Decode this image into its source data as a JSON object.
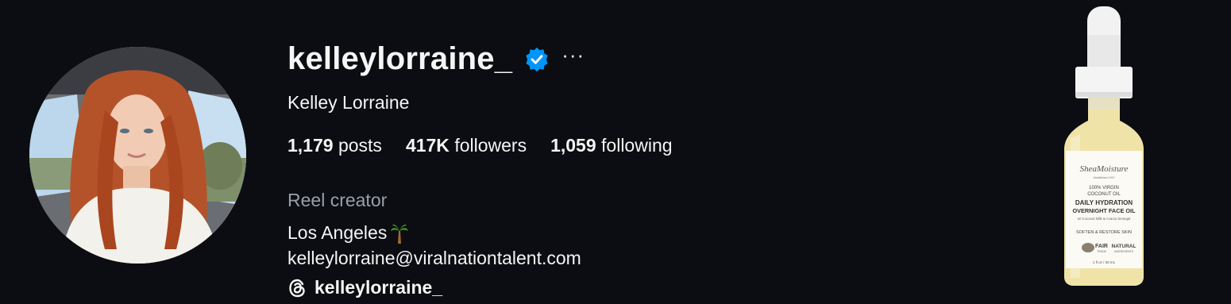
{
  "profile": {
    "username": "kelleylorraine_",
    "verified_icon": "verified-badge-icon",
    "more_label": "···",
    "full_name": "Kelley Lorraine",
    "stats": {
      "posts_count": "1,179",
      "posts_label": "posts",
      "followers_count": "417K",
      "followers_label": "followers",
      "following_count": "1,059",
      "following_label": "following"
    },
    "category": "Reel creator",
    "location": "Los Angeles",
    "location_emoji": "palm-tree-icon",
    "email": "kelleylorraine@viralnationtalent.com",
    "threads_handle": "kelleylorraine_",
    "threads_icon": "threads-icon"
  },
  "product_image": {
    "brand": "SheaMoisture",
    "brand_sub": "Established 1912",
    "line1": "100% VIRGIN",
    "line2": "COCONUT OIL",
    "line3": "DAILY HYDRATION",
    "line4": "OVERNIGHT FACE OIL",
    "line5": "w/ Coconut Milk & Acacia Senegal",
    "line6": "SOFTEN & RESTORE SKIN",
    "badge1": "FAIR",
    "badge1_sub": "TRADE",
    "badge2": "NATURAL",
    "badge2_sub": "INGREDIENTS",
    "volume": "1 fl oz / 30 mL"
  },
  "colors": {
    "background": "#0b0d12",
    "verified_blue": "#0095f6",
    "secondary_text": "#9aa0a6"
  }
}
